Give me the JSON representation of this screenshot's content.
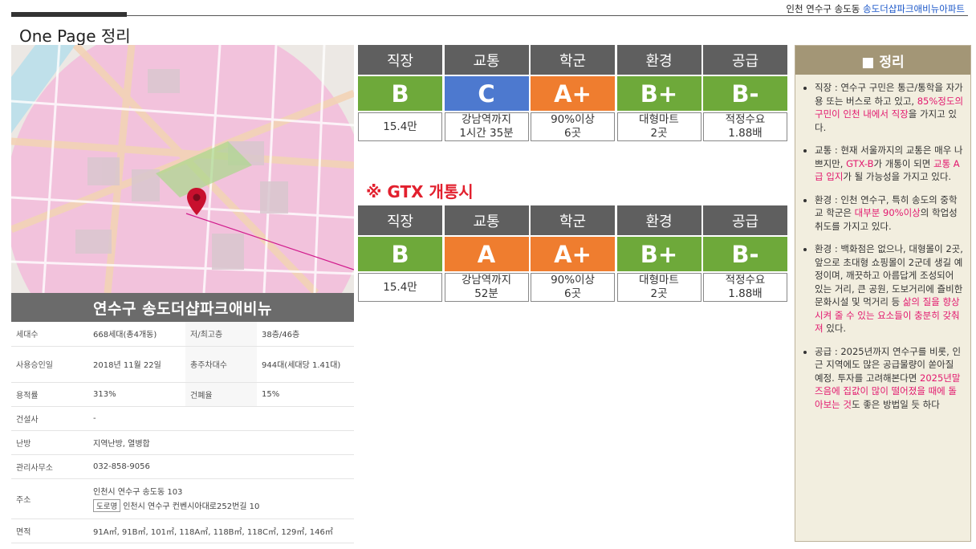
{
  "header": {
    "location_prefix": "인천 연수구 송도동 ",
    "location_name": "송도더샵파크애비뉴아파트",
    "page_title": "One Page 정리"
  },
  "apartment_name": "연수구 송도더샵파크애비뉴",
  "info": {
    "households_label": "세대수",
    "households_value": "668세대(총4개동)",
    "floors_label": "저/최고층",
    "floors_value": "38층/46층",
    "approval_label": "사용승인일",
    "approval_value": "2018년 11월 22일",
    "parking_label": "총주차대수",
    "parking_value": "944대(세대당 1.41대)",
    "far_label": "용적률",
    "far_value": "313%",
    "bcr_label": "건폐율",
    "bcr_value": "15%",
    "builder_label": "건설사",
    "builder_value": "-",
    "heating_label": "난방",
    "heating_value": "지역난방, 열병합",
    "office_label": "관리사무소",
    "office_value": "032-858-9056",
    "address_label": "주소",
    "address_value": "인천시 연수구 송도동 103",
    "road_badge": "도로명",
    "road_value": "인천시 연수구 컨벤시아대로252번길 10",
    "area_label": "면적",
    "area_value": "91A㎡, 91B㎡, 101㎡, 118A㎡, 118B㎡, 118C㎡, 129㎡, 146㎡"
  },
  "grades_current": {
    "headers": [
      "직장",
      "교통",
      "학군",
      "환경",
      "공급"
    ],
    "grades": [
      "B",
      "C",
      "A+",
      "B+",
      "B-"
    ],
    "values": [
      [
        "15.4만"
      ],
      [
        "강남역까지",
        "1시간 35분"
      ],
      [
        "90%이상",
        "6곳"
      ],
      [
        "대형마트",
        "2곳"
      ],
      [
        "적정수요",
        "1.88배"
      ]
    ]
  },
  "gtx_title": "※ GTX 개통시",
  "grades_gtx": {
    "headers": [
      "직장",
      "교통",
      "학군",
      "환경",
      "공급"
    ],
    "grades": [
      "B",
      "A",
      "A+",
      "B+",
      "B-"
    ],
    "values": [
      [
        "15.4만"
      ],
      [
        "강남역까지",
        "52분"
      ],
      [
        "90%이상",
        "6곳"
      ],
      [
        "대형마트",
        "2곳"
      ],
      [
        "적정수요",
        "1.88배"
      ]
    ]
  },
  "colors": {
    "green": "#6ea93a",
    "blue": "#4d79cf",
    "orange": "#ef7d2f",
    "highlight": "#e2186e"
  },
  "summary": {
    "title": "■ 정리",
    "items": [
      {
        "a": "직장 : 연수구 구민은 통근/통학을 자가용 또는 버스로 하고 있고, ",
        "b": "85%정도의 구민이 인천 내에서 직장",
        "c": "을 가지고 있다."
      },
      {
        "a": "교통 : 현재 서울까지의 교통은 매우 나쁘지만, ",
        "b": "GTX-B",
        "c": "가 개통이 되면 ",
        "d": "교통 A급 입지",
        "e": "가 될 가능성을 가지고 있다."
      },
      {
        "a": "환경 : 인천 연수구, 특히 송도의 중학교 학군은 ",
        "b": "대부분 90%이상",
        "c": "의 학업성취도를 가지고 있다."
      },
      {
        "a": "환경 : 백화점은 없으나, 대형몰이 2곳, 앞으로 초대형 쇼핑몰이 2군데 생길 예정이며, 깨끗하고 아름답게 조성되어 있는 거리, 큰 공원, 도보거리에 즐비한 문화시설 및 먹거리 등 ",
        "b": "삶의 질을 향상시켜 줄 수 있는 요소들이 충분히 갖춰져",
        "c": " 있다."
      },
      {
        "a": "공급 : 2025년까지 연수구를 비롯, 인근 지역에도 많은 공급물량이 쏟아질 예정. 투자를 고려해본다면 ",
        "b": "2025년말 즈음에 집값이 많이 떨어졌을 때에 돌아보는 것",
        "c": "도 좋은 방법일 듯 하다"
      }
    ]
  }
}
